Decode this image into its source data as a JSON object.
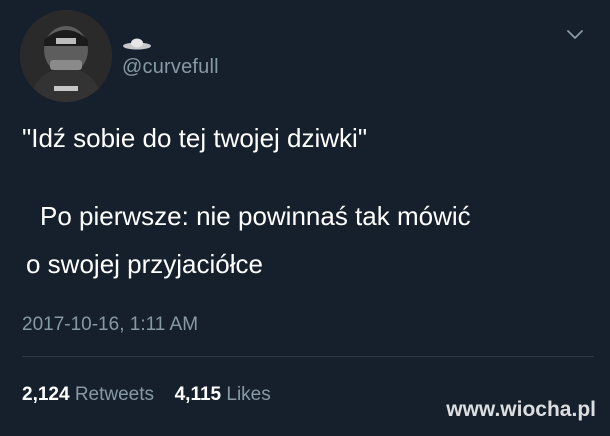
{
  "tweet": {
    "handle": "@curvefull",
    "line1": "\"Idź sobie do tej twojej dziwki\"",
    "line2": "Po pierwsze: nie powinnaś tak mówić",
    "line3": "o swojej przyjaciółce",
    "timestamp": "2017-10-16, 1:11 AM",
    "retweets_count": "2,124",
    "retweets_label": "Retweets",
    "likes_count": "4,115",
    "likes_label": "Likes"
  },
  "watermark": "www.wiocha.pl",
  "colors": {
    "background": "#16202c",
    "text_primary": "#ffffff",
    "text_secondary": "#8899a6"
  },
  "icons": {
    "display_name": "ufo-icon",
    "menu": "chevron-down-icon"
  }
}
